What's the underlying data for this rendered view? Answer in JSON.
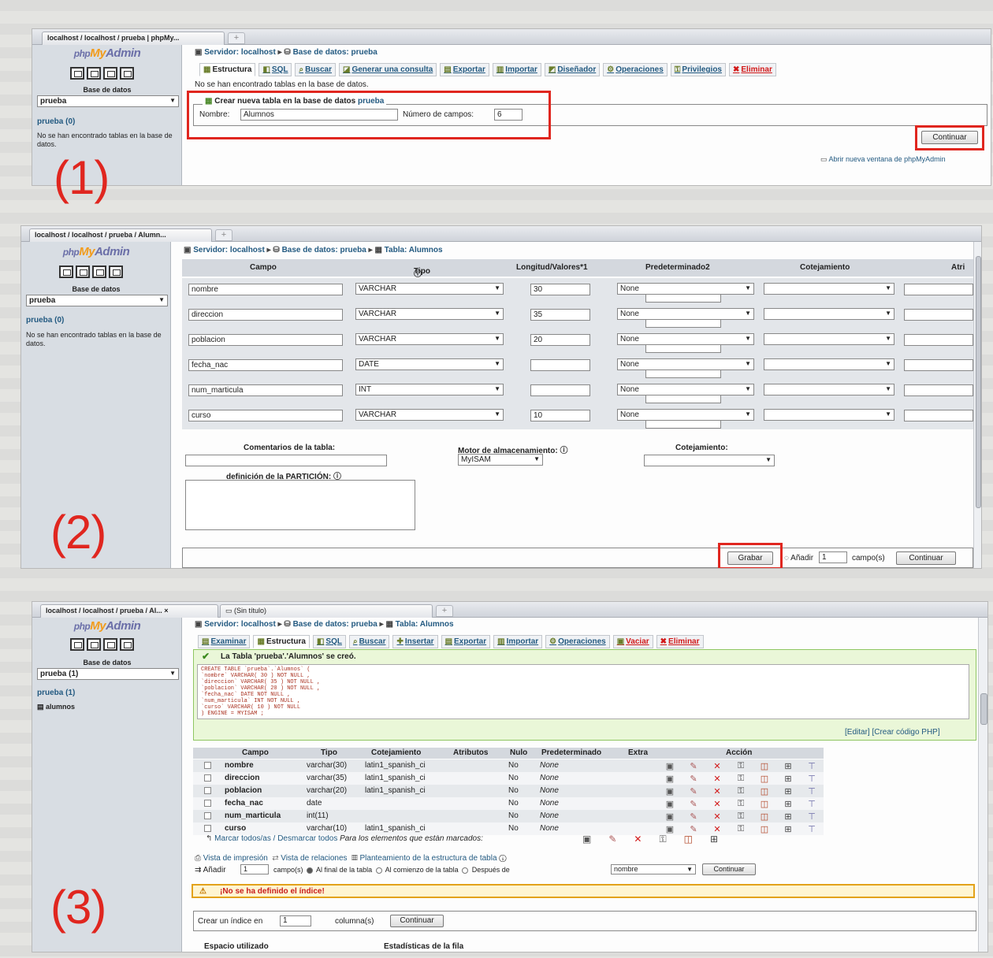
{
  "panel1": {
    "tab_title": "localhost / localhost / prueba | phpMy...",
    "logo": {
      "php": "php",
      "my": "My",
      "admin": "Admin"
    },
    "side_db_label": "Base de datos",
    "side_db_value": "prueba",
    "side_link": "prueba (0)",
    "side_text": "No se han encontrado tablas en la base de datos.",
    "breadcrumb": {
      "server": "Servidor: localhost",
      "db": "Base de datos: prueba"
    },
    "toolbar": [
      "Estructura",
      "SQL",
      "Buscar",
      "Generar una consulta",
      "Exportar",
      "Importar",
      "Diseñador",
      "Operaciones",
      "Privilegios",
      "Eliminar"
    ],
    "no_tables_msg": "No se han encontrado tablas en la base de datos.",
    "legend_text": "Crear nueva tabla en la base de datos",
    "legend_db": "prueba",
    "name_label": "Nombre:",
    "name_value": "Alumnos",
    "fields_label": "Número de campos:",
    "fields_value": "6",
    "continue_button": "Continuar",
    "new_window_link": "Abrir nueva ventana de phpMyAdmin",
    "step_label": "(1)"
  },
  "panel2": {
    "tab_title": "localhost / localhost / prueba / Alumn...",
    "side_db_label": "Base de datos",
    "side_db_value": "prueba",
    "side_link": "prueba (0)",
    "side_text": "No se han encontrado tablas en la base de datos.",
    "breadcrumb": {
      "server": "Servidor: localhost",
      "db": "Base de datos: prueba",
      "table": "Tabla: Alumnos"
    },
    "columns": [
      "Campo",
      "Tipo",
      "Longitud/Valores*1",
      "Predeterminado2",
      "Cotejamiento",
      "Atri"
    ],
    "rows": [
      {
        "campo": "nombre",
        "tipo": "VARCHAR",
        "longitud": "30",
        "predeterminado": "None"
      },
      {
        "campo": "direccion",
        "tipo": "VARCHAR",
        "longitud": "35",
        "predeterminado": "None"
      },
      {
        "campo": "poblacion",
        "tipo": "VARCHAR",
        "longitud": "20",
        "predeterminado": "None"
      },
      {
        "campo": "fecha_nac",
        "tipo": "DATE",
        "longitud": "",
        "predeterminado": "None"
      },
      {
        "campo": "num_marticula",
        "tipo": "INT",
        "longitud": "",
        "predeterminado": "None"
      },
      {
        "campo": "curso",
        "tipo": "VARCHAR",
        "longitud": "10",
        "predeterminado": "None"
      }
    ],
    "comments_label": "Comentarios de la tabla:",
    "engine_label": "Motor de almacenamiento:",
    "engine_value": "MyISAM",
    "collation_label": "Cotejamiento:",
    "partition_label": "definición de la PARTICIÓN:",
    "save_button": "Grabar",
    "add_label": "Añadir",
    "add_value": "1",
    "fields_suffix": "campo(s)",
    "continue_button": "Continuar",
    "step_label": "(2)"
  },
  "panel3": {
    "tab_title": "localhost / localhost / prueba / Al...",
    "tab2_title": "(Sin título)",
    "side_db_label": "Base de datos",
    "side_db_value": "prueba (1)",
    "side_link": "prueba (1)",
    "side_table": "alumnos",
    "breadcrumb": {
      "server": "Servidor: localhost",
      "db": "Base de datos: prueba",
      "table": "Tabla: Alumnos"
    },
    "toolbar": [
      "Examinar",
      "Estructura",
      "SQL",
      "Buscar",
      "Insertar",
      "Exportar",
      "Importar",
      "Operaciones",
      "Vaciar",
      "Eliminar"
    ],
    "success_msg": "La Tabla 'prueba'.'Alumnos' se creó.",
    "sql_text": "CREATE TABLE `prueba`.`Alumnos` (\n`nombre` VARCHAR( 30 ) NOT NULL ,\n`direccion` VARCHAR( 35 ) NOT NULL ,\n`poblacion` VARCHAR( 20 ) NOT NULL ,\n`fecha_nac` DATE NOT NULL ,\n`num_marticula` INT NOT NULL ,\n`curso` VARCHAR( 10 ) NOT NULL\n) ENGINE = MYISAM ;",
    "edit_link": "Editar",
    "php_link": "Crear código PHP",
    "columns": [
      "Campo",
      "Tipo",
      "Cotejamiento",
      "Atributos",
      "Nulo",
      "Predeterminado",
      "Extra",
      "Acción"
    ],
    "rows": [
      {
        "campo": "nombre",
        "tipo": "varchar(30)",
        "cotejamiento": "latin1_spanish_ci",
        "nulo": "No",
        "predeterminado": "None"
      },
      {
        "campo": "direccion",
        "tipo": "varchar(35)",
        "cotejamiento": "latin1_spanish_ci",
        "nulo": "No",
        "predeterminado": "None"
      },
      {
        "campo": "poblacion",
        "tipo": "varchar(20)",
        "cotejamiento": "latin1_spanish_ci",
        "nulo": "No",
        "predeterminado": "None"
      },
      {
        "campo": "fecha_nac",
        "tipo": "date",
        "cotejamiento": "",
        "nulo": "No",
        "predeterminado": "None"
      },
      {
        "campo": "num_marticula",
        "tipo": "int(11)",
        "cotejamiento": "",
        "nulo": "No",
        "predeterminado": "None"
      },
      {
        "campo": "curso",
        "tipo": "varchar(10)",
        "cotejamiento": "latin1_spanish_ci",
        "nulo": "No",
        "predeterminado": "None"
      }
    ],
    "mark_all": "Marcar todos/as / Desmarcar todos",
    "mark_suffix": "Para los elementos que están marcados:",
    "print_view": "Vista de impresión",
    "relations_view": "Vista de relaciones",
    "structure_plan": "Planteamiento de la estructura de tabla",
    "add_label": "Añadir",
    "add_value": "1",
    "fields_suffix": "campo(s)",
    "at_end": "Al final de la tabla",
    "at_start": "Al comienzo de la tabla",
    "after": "Después de",
    "after_value": "nombre",
    "continue_button": "Continuar",
    "warning": "¡No se ha definido el índice!",
    "create_index": "Crear un índice en",
    "index_value": "1",
    "index_suffix": "columna(s)",
    "space_used": "Espacio utilizado",
    "row_stats": "Estadísticas de la fila",
    "step_label": "(3)"
  }
}
